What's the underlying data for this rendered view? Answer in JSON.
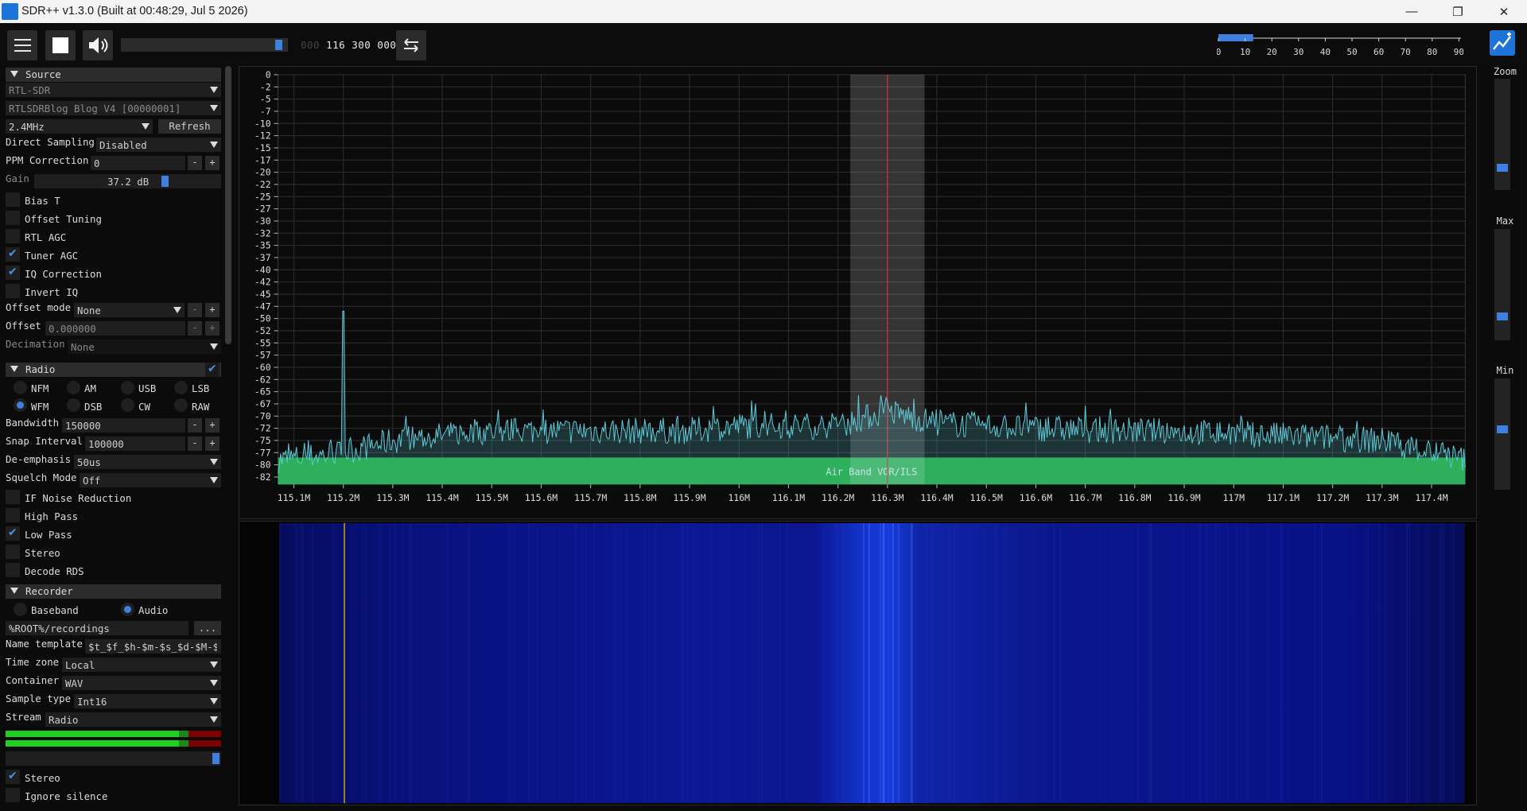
{
  "window": {
    "title": "SDR++ v1.3.0 (Built at 00:48:29, Jul  5 2026)",
    "minimize": "—",
    "restore": "❐",
    "close": "✕"
  },
  "toolbar": {
    "frequency_dim": "000 ",
    "frequency_lit": "116 300 000",
    "volume_level": 0.98,
    "snr_scale": [
      "0",
      "10",
      "20",
      "30",
      "40",
      "50",
      "60",
      "70",
      "80",
      "90"
    ],
    "snr_level": 13
  },
  "source": {
    "header": "Source",
    "device_type": "RTL-SDR",
    "device": "RTLSDRBlog Blog V4 [00000001]",
    "sample_rate": "2.4MHz",
    "refresh": "Refresh",
    "direct_sampling_label": "Direct Sampling",
    "direct_sampling": "Disabled",
    "ppm_label": "PPM Correction",
    "ppm": "0",
    "gain_label": "Gain",
    "gain": "37.2 dB",
    "bias_t": "Bias T",
    "offset_tuning": "Offset Tuning",
    "rtl_agc": "RTL AGC",
    "tuner_agc": "Tuner AGC",
    "iq_correction": "IQ Correction",
    "invert_iq": "Invert IQ",
    "offset_mode_label": "Offset mode",
    "offset_mode": "None",
    "offset_label": "Offset",
    "offset": "0.000000",
    "decimation_label": "Decimation",
    "decimation": "None",
    "minus": "-",
    "plus": "+"
  },
  "radio": {
    "header": "Radio",
    "modes": [
      "NFM",
      "AM",
      "USB",
      "LSB",
      "WFM",
      "DSB",
      "CW",
      "RAW"
    ],
    "bandwidth_label": "Bandwidth",
    "bandwidth": "150000",
    "snap_label": "Snap Interval",
    "snap": "100000",
    "deemph_label": "De-emphasis",
    "deemph": "50us",
    "squelch_label": "Squelch Mode",
    "squelch": "Off",
    "if_nr": "IF Noise Reduction",
    "high_pass": "High Pass",
    "low_pass": "Low Pass",
    "stereo": "Stereo",
    "rds": "Decode RDS"
  },
  "recorder": {
    "header": "Recorder",
    "baseband": "Baseband",
    "audio": "Audio",
    "path": "%ROOT%/recordings",
    "browse": "...",
    "name_template_label": "Name template",
    "name_template": "$t_$f_$h-$m-$s_$d-$M-$y",
    "timezone_label": "Time zone",
    "timezone": "Local",
    "container_label": "Container",
    "container": "WAV",
    "sample_type_label": "Sample type",
    "sample_type": "Int16",
    "stream_label": "Stream",
    "stream": "Radio",
    "stereo": "Stereo",
    "ignore_silence": "Ignore silence"
  },
  "right": {
    "zoom": "Zoom",
    "max": "Max",
    "min": "Min",
    "zoom_level": 0.82,
    "max_level": 0.81,
    "min_level": 0.45
  },
  "colors": {
    "accent": "#3f7fe0",
    "trace": "#5fc9d8",
    "bandplan": "#1fa83a",
    "vfo_line": "#e03030",
    "waterfall_line": "#e6c000"
  },
  "chart_data": {
    "type": "line",
    "title": "",
    "ylabel": "",
    "xlabel": "",
    "yticks": [
      "0",
      "-2",
      "-5",
      "-7",
      "-10",
      "-12",
      "-15",
      "-17",
      "-20",
      "-22",
      "-25",
      "-27",
      "-30",
      "-32",
      "-35",
      "-37",
      "-40",
      "-42",
      "-45",
      "-47",
      "-50",
      "-52",
      "-55",
      "-57",
      "-60",
      "-62",
      "-65",
      "-67",
      "-70",
      "-72",
      "-75",
      "-77",
      "-80",
      "-82"
    ],
    "ytick_values": [
      0,
      -2.5,
      -5,
      -7.5,
      -10,
      -12.5,
      -15,
      -17.5,
      -20,
      -22.5,
      -25,
      -27.5,
      -30,
      -32.5,
      -35,
      -37.5,
      -40,
      -42.5,
      -45,
      -47.5,
      -50,
      -52.5,
      -55,
      -57.5,
      -60,
      -62.5,
      -65,
      -67.5,
      -70,
      -72.5,
      -75,
      -77.5,
      -80,
      -82.5
    ],
    "ylim": [
      -84,
      0
    ],
    "xticks": [
      "115.1M",
      "115.2M",
      "115.3M",
      "115.4M",
      "115.5M",
      "115.6M",
      "115.7M",
      "115.8M",
      "115.9M",
      "116M",
      "116.1M",
      "116.2M",
      "116.3M",
      "116.4M",
      "116.5M",
      "116.6M",
      "116.7M",
      "116.8M",
      "116.9M",
      "117M",
      "117.1M",
      "117.2M",
      "117.3M",
      "117.4M"
    ],
    "xtick_values": [
      115.1,
      115.2,
      115.3,
      115.4,
      115.5,
      115.6,
      115.7,
      115.8,
      115.9,
      116.0,
      116.1,
      116.2,
      116.3,
      116.4,
      116.5,
      116.6,
      116.7,
      116.8,
      116.9,
      117.0,
      117.1,
      117.2,
      117.3,
      117.4
    ],
    "xlim": [
      115.068,
      117.468
    ],
    "vfo_center_mhz": 116.3,
    "vfo_bandwidth_mhz": 0.15,
    "bandplan_label": "Air Band VOR/ILS",
    "bandplan_top_db": -78.5,
    "peak": {
      "x_mhz": 115.2,
      "y_db": -48.5
    },
    "noise_profile": [
      {
        "x": 115.07,
        "db": -79
      },
      {
        "x": 115.2,
        "db": -77.5
      },
      {
        "x": 115.3,
        "db": -75
      },
      {
        "x": 115.5,
        "db": -73
      },
      {
        "x": 115.9,
        "db": -73
      },
      {
        "x": 116.0,
        "db": -72
      },
      {
        "x": 116.2,
        "db": -72
      },
      {
        "x": 116.3,
        "db": -69
      },
      {
        "x": 116.4,
        "db": -71.5
      },
      {
        "x": 116.6,
        "db": -72.5
      },
      {
        "x": 117.0,
        "db": -73.5
      },
      {
        "x": 117.3,
        "db": -75
      },
      {
        "x": 117.468,
        "db": -79
      }
    ]
  }
}
